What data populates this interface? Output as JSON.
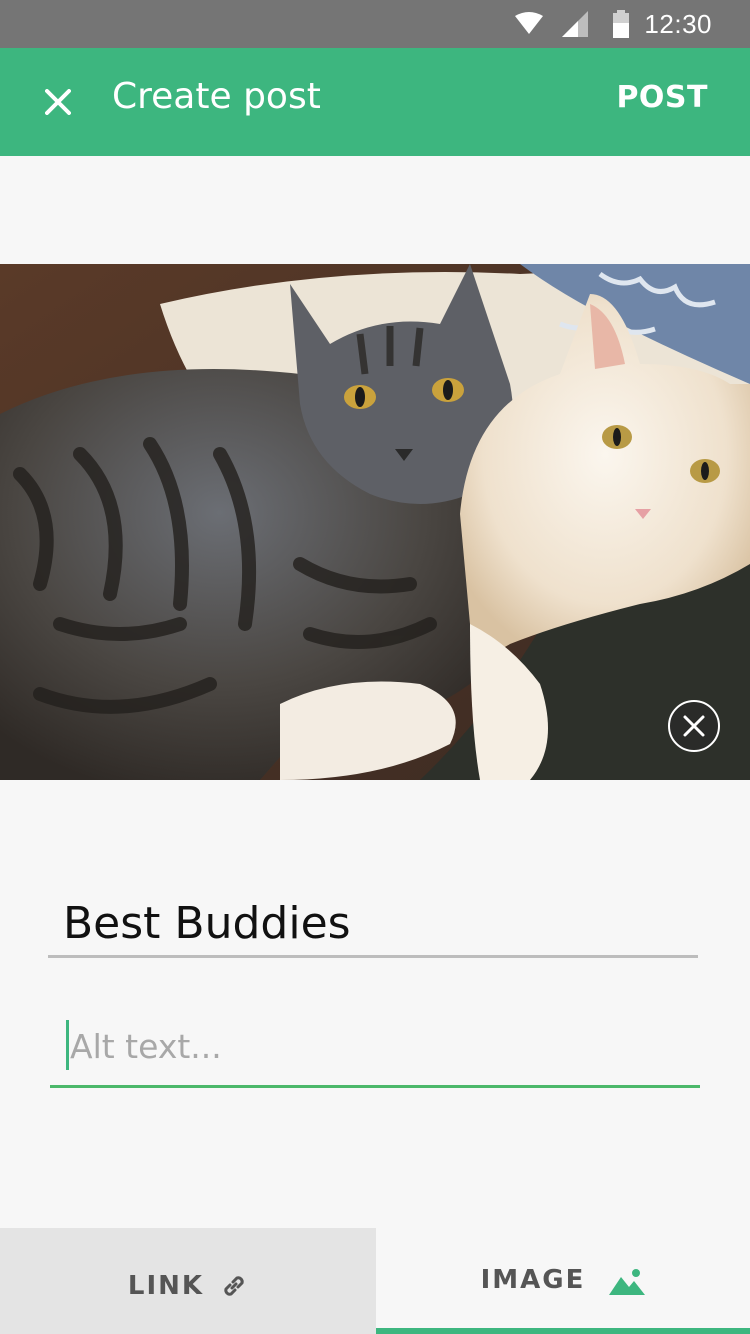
{
  "status_bar": {
    "time": "12:30",
    "icons": [
      "wifi-icon",
      "signal-icon",
      "battery-icon"
    ]
  },
  "app_bar": {
    "close_icon": "close-icon",
    "title": "Create post",
    "post_label": "POST",
    "color": "#3db67f"
  },
  "photo": {
    "remove_icon": "close-circle-icon"
  },
  "form": {
    "title_value": "Best Buddies",
    "alt_placeholder": "Alt text...",
    "alt_value": "",
    "focus_color": "#4cb86a"
  },
  "bottom_tabs": {
    "link": {
      "label": "LINK",
      "icon": "link-icon"
    },
    "image": {
      "label": "IMAGE",
      "icon": "image-icon",
      "selected": true
    }
  }
}
